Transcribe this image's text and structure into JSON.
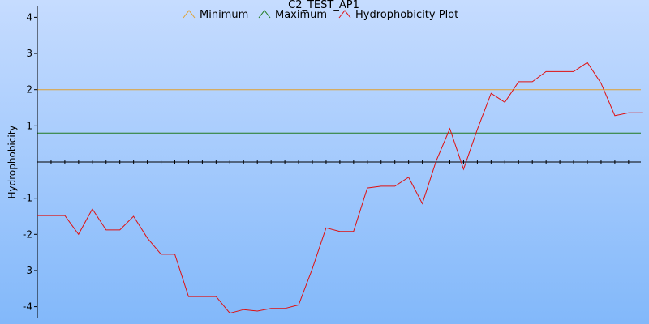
{
  "chart_data": {
    "type": "line",
    "title": "C2_TEST_AP1",
    "ylabel": "Hydrophobicity",
    "xlabel": "",
    "ylim": [
      -4.3,
      4.3
    ],
    "yticks": [
      4,
      3,
      2,
      1,
      -1,
      -2,
      -3,
      -4
    ],
    "x_tick_count": 46,
    "grid": false,
    "legend_position": "top-center",
    "colors": {
      "background_top": "#c6dcff",
      "background_bottom": "#82b8fa",
      "minimum": "#e0a030",
      "maximum": "#207a20",
      "plot": "#e01010",
      "axis": "#000000"
    },
    "series": [
      {
        "name": "Minimum",
        "values": [
          2.0,
          2.0
        ],
        "kind": "threshold"
      },
      {
        "name": "Maximum",
        "values": [
          0.8,
          0.8
        ],
        "kind": "threshold"
      },
      {
        "name": "Hydrophobicity Plot",
        "values": [
          -1.48,
          -1.48,
          -1.48,
          -2.0,
          -1.3,
          -1.88,
          -1.88,
          -1.5,
          -2.1,
          -2.55,
          -2.55,
          -3.72,
          -3.72,
          -3.72,
          -4.18,
          -4.08,
          -4.12,
          -4.05,
          -4.05,
          -3.95,
          -2.95,
          -1.82,
          -1.92,
          -1.92,
          -0.72,
          -0.67,
          -0.67,
          -0.42,
          -1.15,
          0.02,
          0.92,
          -0.2,
          0.9,
          1.9,
          1.65,
          2.22,
          2.22,
          2.5,
          2.5,
          2.5,
          2.75,
          2.18,
          1.28,
          1.36,
          1.36
        ]
      }
    ]
  }
}
